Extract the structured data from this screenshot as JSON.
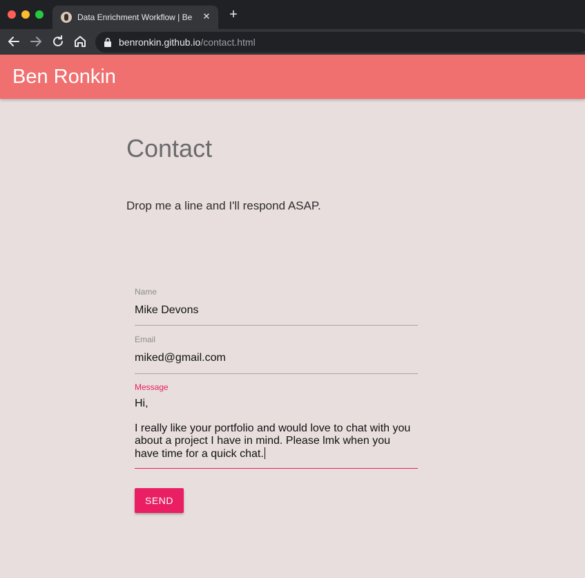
{
  "browser": {
    "tab_title": "Data Enrichment Workflow | Be",
    "tab_close": "✕",
    "new_tab": "+",
    "url_host": "benronkin.github.io",
    "url_path": "/contact.html",
    "icons": [
      "back-arrow-icon",
      "forward-arrow-icon",
      "reload-icon",
      "home-icon",
      "lock-icon"
    ],
    "colors": {
      "tabbar": "#202124",
      "toolbar": "#35363a"
    }
  },
  "header": {
    "site_name": "Ben Ronkin",
    "color": "#f07070"
  },
  "main": {
    "title": "Contact",
    "intro": "Drop me a line and I'll respond ASAP."
  },
  "form": {
    "name_label": "Name",
    "name_value": "Mike Devons",
    "email_label": "Email",
    "email_value": "miked@gmail.com",
    "message_label": "Message",
    "message_lines": [
      "Hi,",
      "",
      "I really like your portfolio and would love to chat with you",
      "about a project I have in mind. Please lmk when you",
      "have time for a quick chat."
    ],
    "send_label": "SEND",
    "accent_color": "#e91e63"
  }
}
